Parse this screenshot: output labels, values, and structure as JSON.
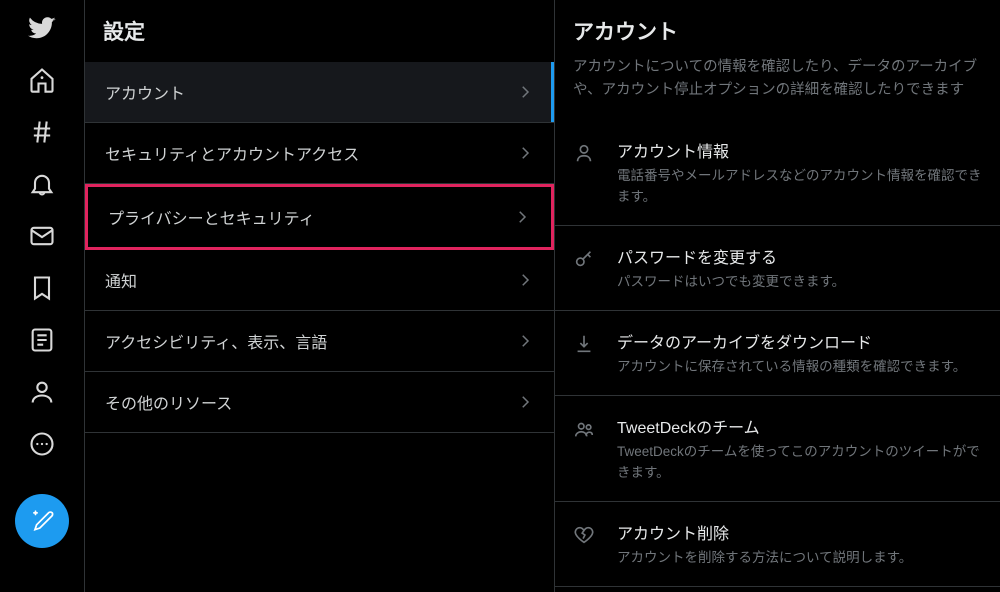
{
  "settings": {
    "title": "設定",
    "items": [
      {
        "label": "アカウント"
      },
      {
        "label": "セキュリティとアカウントアクセス"
      },
      {
        "label": "プライバシーとセキュリティ"
      },
      {
        "label": "通知"
      },
      {
        "label": "アクセシビリティ、表示、言語"
      },
      {
        "label": "その他のリソース"
      }
    ]
  },
  "detail": {
    "title": "アカウント",
    "description": "アカウントについての情報を確認したり、データのアーカイブや、アカウント停止オプションの詳細を確認したりできます",
    "items": [
      {
        "label": "アカウント情報",
        "sub": "電話番号やメールアドレスなどのアカウント情報を確認できます。"
      },
      {
        "label": "パスワードを変更する",
        "sub": "パスワードはいつでも変更できます。"
      },
      {
        "label": "データのアーカイブをダウンロード",
        "sub": "アカウントに保存されている情報の種類を確認できます。"
      },
      {
        "label": "TweetDeckのチーム",
        "sub": "TweetDeckのチームを使ってこのアカウントのツイートができます。"
      },
      {
        "label": "アカウント削除",
        "sub": "アカウントを削除する方法について説明します。"
      }
    ]
  }
}
